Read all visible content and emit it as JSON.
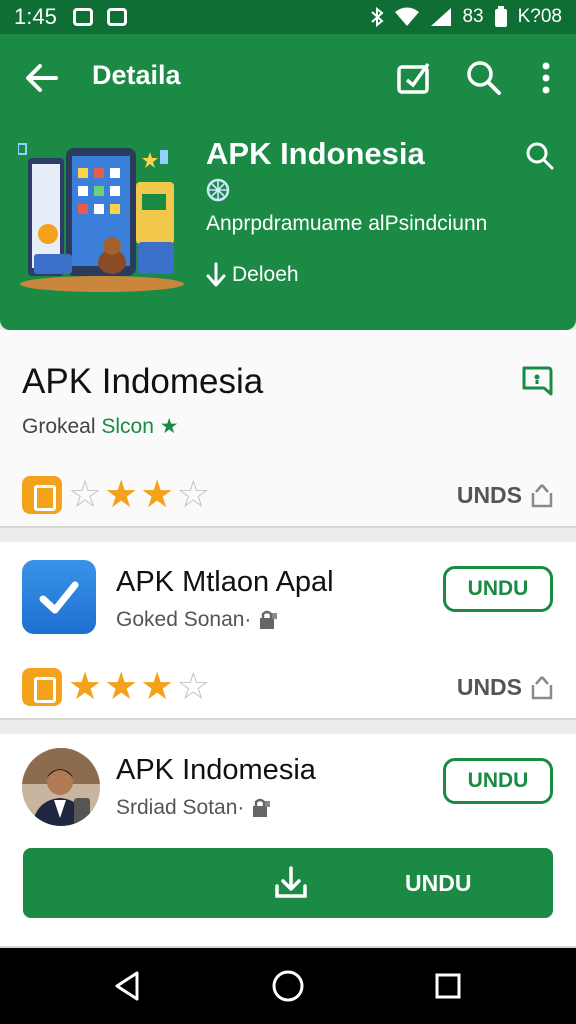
{
  "status_bar": {
    "time": "1:45",
    "right_text": "83",
    "battery_text": "K?08"
  },
  "toolbar": {
    "title": "Detaila",
    "icons": [
      "back-arrow-icon",
      "edit-icon",
      "search-icon",
      "more-vert-icon"
    ]
  },
  "hero": {
    "title": "APK Indonesia",
    "subtitle": "Anprpdramuame alPsindciunn",
    "download_label": "Deloeh"
  },
  "featured": {
    "title": "APK Indomesia",
    "subtitle_prefix": "Grokeal",
    "subtitle_accent": "Slcon",
    "rating": 3,
    "max_rating": 5,
    "action_label": "UNDS"
  },
  "apps": [
    {
      "name": "APK Mtlaon Apal",
      "developer": "Goked Sonan·",
      "button_label": "UNDU",
      "rating": 4,
      "max_rating": 5,
      "action_label": "UNDS"
    },
    {
      "name": "APK Indomesia",
      "developer": "Srdiad Sotan·",
      "button_label": "UNDU",
      "big_button_label": "UNDU"
    }
  ],
  "colors": {
    "primary": "#1b8a45",
    "status": "#0f6e33",
    "star": "#f4a21b"
  }
}
